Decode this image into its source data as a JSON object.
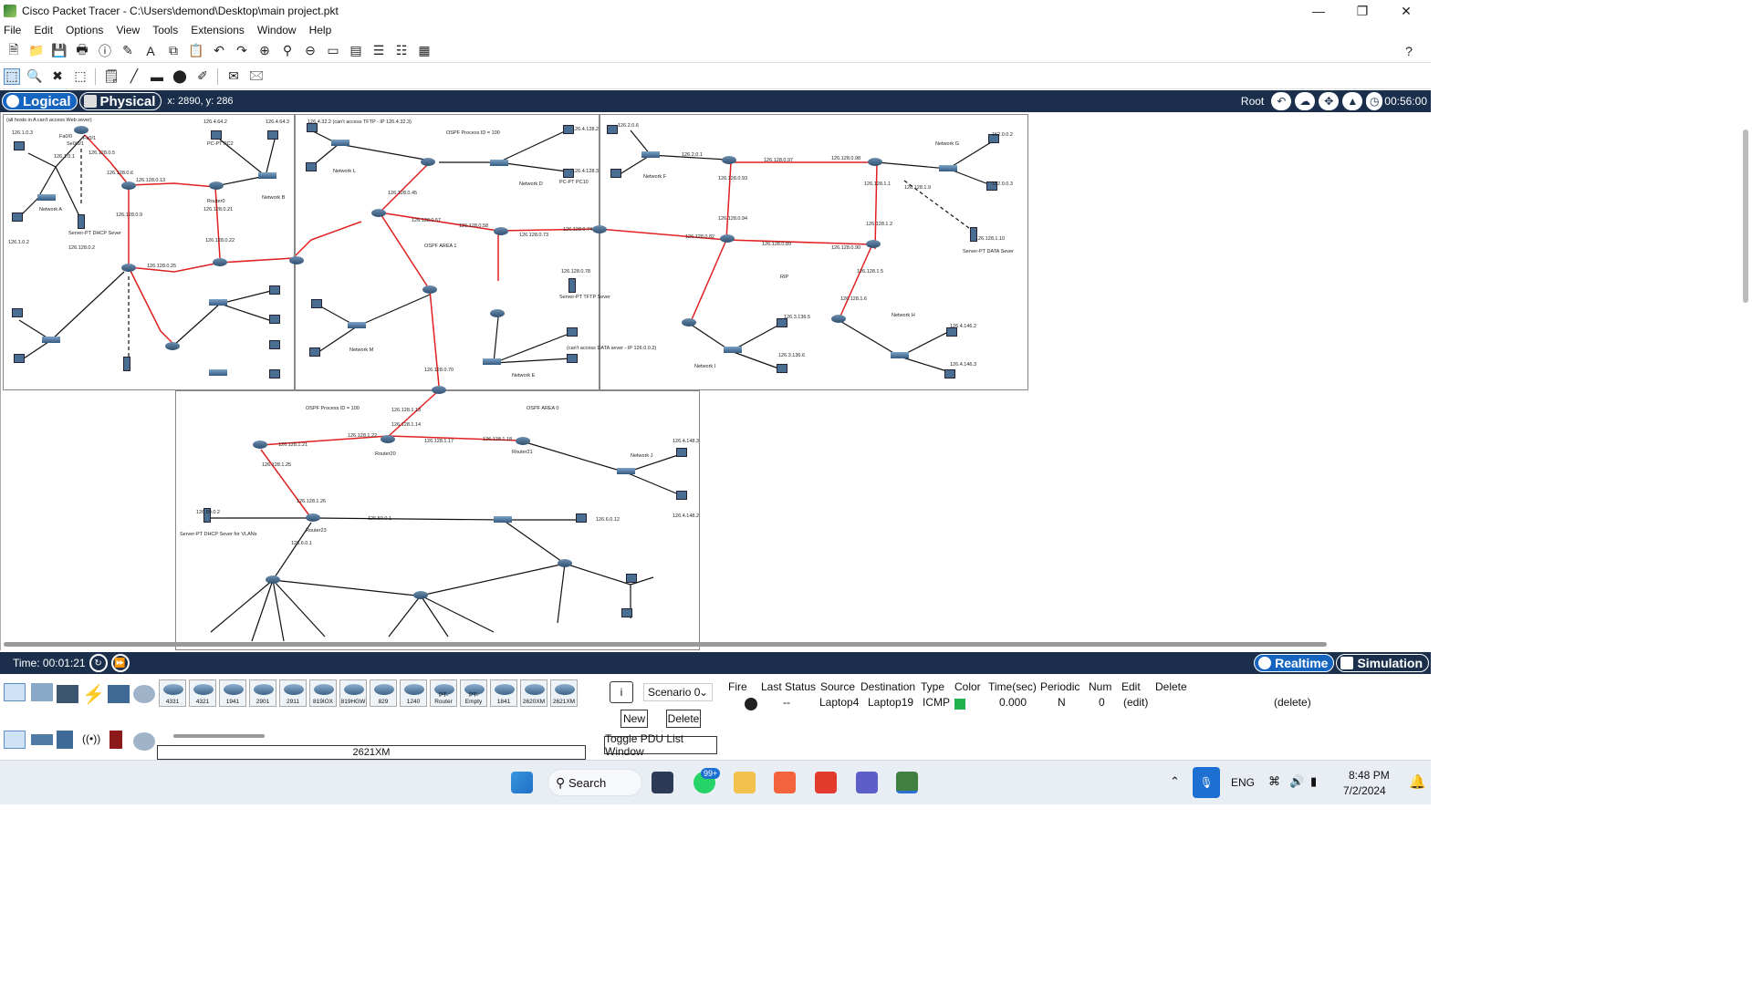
{
  "window": {
    "title": "Cisco Packet Tracer - C:\\Users\\demond\\Desktop\\main project.pkt",
    "minimize": "—",
    "maximize": "❐",
    "close": "✕"
  },
  "menu": [
    "File",
    "Edit",
    "Options",
    "View",
    "Tools",
    "Extensions",
    "Window",
    "Help"
  ],
  "mode_bar": {
    "logical": "Logical",
    "physical": "Physical",
    "coords": "x: 2890, y: 286",
    "root": "Root",
    "clock": "00:56:00"
  },
  "workspace_labels": {
    "a1": "(all hosts in A can't access Web sever)",
    "a2": "126.1.0.3",
    "a3": "Fa0/0",
    "a4": "Fa0/1",
    "a5": "Se0/0/1",
    "a6": "126.128.0.5",
    "a7": "126.1.0.1",
    "a8": "126.128.0.6",
    "a9": "126.128.0.13",
    "a10": "Network A",
    "a11": "Server-PT DHCP Sever",
    "a12": "126.128.0.2",
    "a13": "126.1.0.2",
    "b1": "126.4.64.2",
    "b2": "126.4.64.3",
    "b3": "PC-PT PC2",
    "b4": "Network B",
    "b5": "126.128.0.21",
    "b6": "126.128.0.22",
    "b7": "126.128.0.25",
    "b8": "126.128.0.9",
    "b9": "Router0",
    "c1": "126.4.32.2 (can't access TFTP - IP 126.4.32.3)",
    "c2": "OSPF Process ID = 100",
    "c3": "Network L",
    "c4": "Network D",
    "c5": "126.4.128.2",
    "c6": "126.4.128.3",
    "c7": "PC-PT PC10",
    "c8": "OSPF AREA 1",
    "c9": "126.128.0.45",
    "c10": "126.128.0.57",
    "c11": "126.128.0.58",
    "c12": "126.128.0.73",
    "c13": "126.128.0.74",
    "c14": "126.128.0.78",
    "c15": "Server-PT TFTP Sever",
    "c16": "(can't access DATA sever - IP 126.0.0.2)",
    "c17": "Network E",
    "c18": "Network M",
    "c19": "126.128.0.70",
    "d1": "126.2.0.6",
    "d2": "Network F",
    "d3": "126.2.0.1",
    "d4": "126.128.0.93",
    "d5": "126.128.0.97",
    "d6": "126.128.0.98",
    "d7": "126.128.0.94",
    "d8": "126.128.0.82",
    "d9": "126.128.0.89",
    "d10": "126.128.0.90",
    "d11": "RIP",
    "d12": "Network I",
    "d13": "126.3.136.5",
    "d14": "126.3.136.6",
    "e1": "Network G",
    "e2": "152.0.0.2",
    "e3": "152.0.0.3",
    "e4": "126.128.1.9",
    "e5": "126.128.1.1",
    "e6": "126.128.1.2",
    "e7": "126.128.1.5",
    "e8": "126.128.1.6",
    "e9": "Network H",
    "e10": "Server-PT DATA Sever",
    "e11": "126.128.1.10",
    "e12": "126.4.146.2",
    "e13": "126.4.146.3",
    "f1": "OSPF Process ID = 100",
    "f2": "OSPF AREA 0",
    "f3": "126.128.1.13",
    "f4": "126.128.1.14",
    "f5": "126.128.1.21",
    "f6": "126.128.1.22",
    "f7": "126.128.1.17",
    "f8": "126.128.1.18",
    "f9": "126.128.1.25",
    "f10": "126.128.1.26",
    "f11": "Network J",
    "f12": "126.4.148.3",
    "f13": "126.4.148.2",
    "f14": "Server-PT DHCP Sever for VLANs",
    "f15": "126.80.0.2",
    "f16": "126.50.0.1",
    "f17": "126.6.0.12",
    "f18": "126.6.0.1",
    "f19": "Router23",
    "f20": "Router20",
    "f21": "Router21"
  },
  "sim_bar": {
    "time": "Time: 00:01:21",
    "realtime": "Realtime",
    "simulation": "Simulation"
  },
  "device_models": [
    "4331",
    "4321",
    "1941",
    "2901",
    "2911",
    "819IOX",
    "819HGW",
    "829",
    "1240",
    "PT-Router",
    "PT-Empty",
    "1841",
    "2620XM",
    "2621XM"
  ],
  "selected_model": "2621XM",
  "scenario": {
    "select": "Scenario 0",
    "new": "New",
    "delete": "Delete",
    "toggle": "Toggle PDU List Window"
  },
  "pdu_headers": [
    "Fire",
    "Last Status",
    "Source",
    "Destination",
    "Type",
    "Color",
    "Time(sec)",
    "Periodic",
    "Num",
    "Edit",
    "Delete"
  ],
  "pdu_row": {
    "last_status": "--",
    "source": "Laptop4",
    "destination": "Laptop19",
    "type": "ICMP",
    "color": "#22b14c",
    "time": "0.000",
    "periodic": "N",
    "num": "0",
    "edit": "(edit)",
    "delete": "(delete)"
  },
  "taskbar": {
    "search": "Search",
    "badge": "99+",
    "lang": "ENG",
    "time": "8:48 PM",
    "date": "7/2/2024"
  }
}
